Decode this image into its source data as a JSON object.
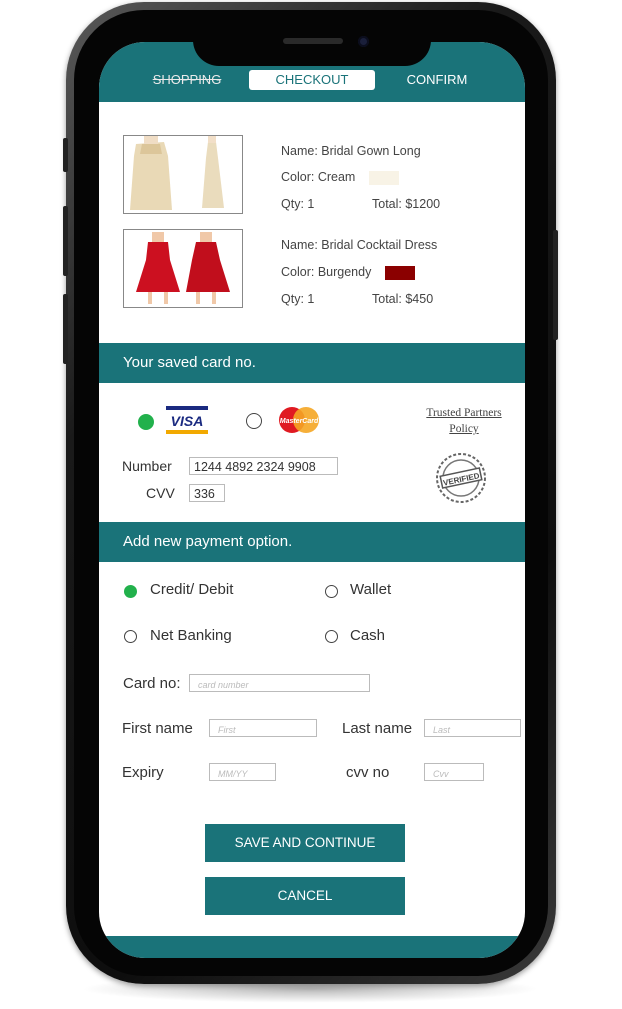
{
  "steps": {
    "shopping": "SHOPPING",
    "checkout": "CHECKOUT",
    "confirm": "CONFIRM"
  },
  "cart": {
    "items": [
      {
        "name": "Name: Bridal Gown Long",
        "color": "Color: Cream",
        "swatch": "#f8f3e6",
        "qty": "Qty: 1",
        "total": "Total: $1200"
      },
      {
        "name": "Name: Bridal Cocktail Dress",
        "color": "Color: Burgendy",
        "swatch": "#8b0000",
        "qty": "Qty: 1",
        "total": "Total: $450"
      }
    ]
  },
  "saved_card": {
    "heading": "Your saved card no.",
    "visa_label": "VISA",
    "mastercard_label": "MasterCard",
    "number_label": "Number",
    "number_value": "1244 4892 2324 9908",
    "cvv_label": "CVV",
    "cvv_value": "336",
    "trusted_link": "Trusted Partners",
    "trusted_link2": "Policy",
    "verified_seal": "VERIFIED"
  },
  "new_payment": {
    "heading": "Add new payment option.",
    "options": [
      "Credit/ Debit",
      "Wallet",
      "Net Banking",
      "Cash"
    ],
    "card_no_label": "Card no:",
    "card_no_placeholder": "card number",
    "first_name_label": "First name",
    "first_name_placeholder": "First",
    "last_name_label": "Last name",
    "last_name_placeholder": "Last",
    "expiry_label": "Expiry",
    "expiry_placeholder": "MM/YY",
    "cvv_label": "cvv no",
    "cvv_placeholder": "Cvv"
  },
  "actions": {
    "save": "SAVE AND CONTINUE",
    "cancel": "CANCEL"
  },
  "colors": {
    "accent": "#1a7379",
    "selected_radio": "#22b14c"
  }
}
